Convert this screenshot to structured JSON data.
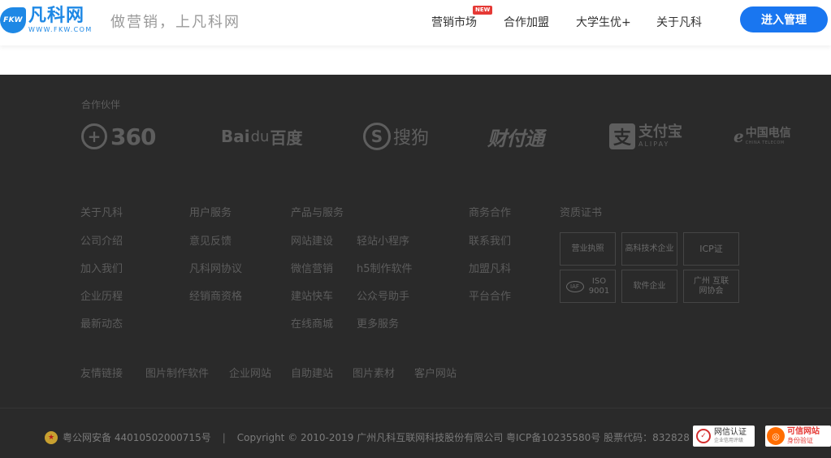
{
  "header": {
    "logo_badge": "FKW",
    "logo_cn": "凡科网",
    "logo_en": "WWW.FKW.COM",
    "slogan": "做营销，上凡科网",
    "nav": [
      {
        "label": "营销市场"
      },
      {
        "label": "合作加盟"
      },
      {
        "label": "大学生优+"
      },
      {
        "label": "关于凡科"
      }
    ],
    "new_badge": "NEW",
    "enter_button": "进入管理",
    "accent_color": "#1976f0"
  },
  "partners": {
    "label": "合作伙伴",
    "p360": {
      "symbol": "+",
      "text": "360"
    },
    "baidu": {
      "t1": "Bai",
      "paw": "du",
      "t2": "百度"
    },
    "sogou": {
      "symbol": "S",
      "text": "搜狗"
    },
    "caifutong": {
      "text": "财付通"
    },
    "alipay": {
      "symbol": "支",
      "cn": "支付宝",
      "en": "ALIPAY"
    },
    "telecom": {
      "symbol": "ℯ",
      "cn": "中国电信",
      "en": "CHINA TELECOM"
    }
  },
  "columns": {
    "about": {
      "title": "关于凡科",
      "links": [
        "公司介绍",
        "加入我们",
        "企业历程",
        "最新动态"
      ]
    },
    "user": {
      "title": "用户服务",
      "links": [
        "意见反馈",
        "凡科网协议",
        "经销商资格"
      ]
    },
    "product": {
      "title": "产品与服务",
      "links_a": [
        "网站建设",
        "微信营销",
        "建站快车",
        "在线商城"
      ],
      "links_b": [
        "轻站小程序",
        "h5制作软件",
        "公众号助手",
        "更多服务"
      ]
    },
    "business": {
      "title": "商务合作",
      "links": [
        "联系我们",
        "加盟凡科",
        "平台合作"
      ]
    },
    "certs": {
      "title": "资质证书",
      "items": [
        "营业执照",
        "高科技术企业",
        "ICP证",
        "ISO 9001",
        "软件企业",
        "广州 互联网协会"
      ],
      "iso_icon": "IAF"
    }
  },
  "friend_links": [
    "友情链接",
    "图片制作软件",
    "企业网站",
    "自助建站",
    "图片素材",
    "客户网站"
  ],
  "bottom": {
    "police_emblem": "★",
    "police": "粤公网安备 44010502000715号",
    "sep": "|",
    "copyright": "Copyright © 2010-2019 广州凡科互联网科技股份有限公司 粤ICP备10235580号 股票代码：832828",
    "badge_net": {
      "icon": "✓",
      "a": "网信认证",
      "b": "企业信用评级"
    },
    "badge_trust": {
      "icon": "◎",
      "a": "可信网站",
      "b": "身份验证"
    }
  }
}
